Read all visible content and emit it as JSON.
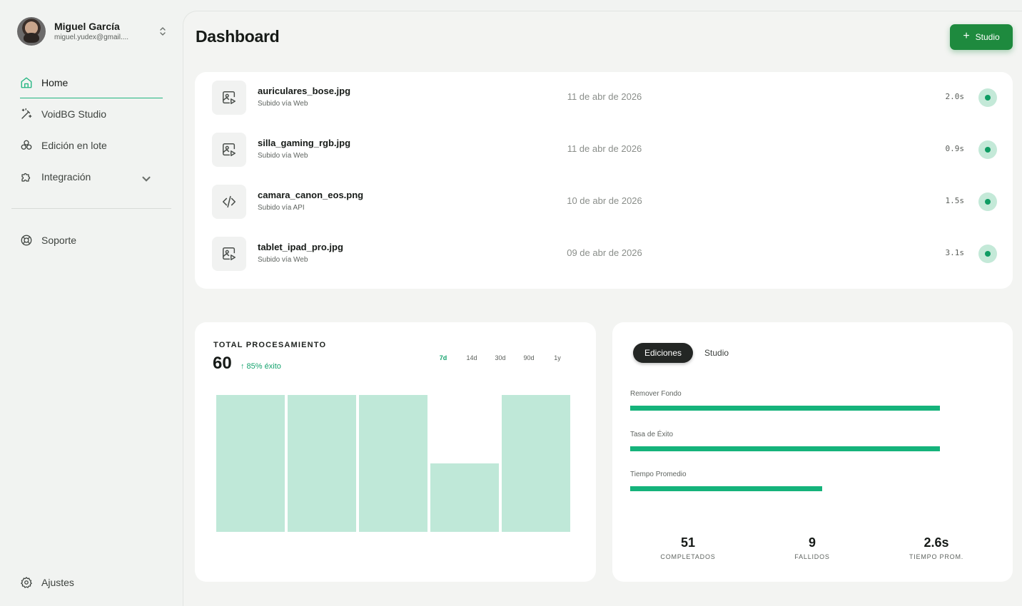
{
  "user": {
    "name": "Miguel García",
    "email": "miguel.yudex@gmail...."
  },
  "nav": {
    "items": [
      {
        "label": "Home",
        "icon": "home-icon",
        "active": true
      },
      {
        "label": "VoidBG Studio",
        "icon": "magic-wand-icon"
      },
      {
        "label": "Edición en lote",
        "icon": "batch-icon"
      },
      {
        "label": "Integración",
        "icon": "puzzle-icon",
        "has_submenu": true
      }
    ],
    "support": {
      "label": "Soporte",
      "icon": "lifebuoy-icon"
    },
    "settings": {
      "label": "Ajustes",
      "icon": "gear-icon"
    }
  },
  "header": {
    "title": "Dashboard",
    "studio_button": "Studio"
  },
  "files": [
    {
      "name": "auriculares_bose.jpg",
      "source": "Subido vía Web",
      "date": "11 de abr de 2026",
      "time": "2.0s",
      "icon": "image-play-icon"
    },
    {
      "name": "silla_gaming_rgb.jpg",
      "source": "Subido vía Web",
      "date": "11 de abr de 2026",
      "time": "0.9s",
      "icon": "image-play-icon"
    },
    {
      "name": "camara_canon_eos.png",
      "source": "Subido vía API",
      "date": "10 de abr de 2026",
      "time": "1.5s",
      "icon": "code-icon"
    },
    {
      "name": "tablet_ipad_pro.jpg",
      "source": "Subido vía Web",
      "date": "09 de abr de 2026",
      "time": "3.1s",
      "icon": "image-play-icon"
    }
  ],
  "processing": {
    "title": "TOTAL PROCESAMIENTO",
    "total": "60",
    "growth": "↑ 85% éxito",
    "ranges": [
      "7d",
      "14d",
      "30d",
      "90d",
      "1y"
    ],
    "active_range": "7d"
  },
  "chart_data": {
    "type": "bar",
    "values": [
      100,
      100,
      100,
      50,
      100
    ],
    "ylim": [
      0,
      100
    ],
    "color": "#bfe8d8",
    "grid": false
  },
  "stats": {
    "tabs": [
      "Ediciones",
      "Studio"
    ],
    "active_tab": "Ediciones",
    "metrics": [
      {
        "label": "Remover Fondo",
        "fraction": 1.0
      },
      {
        "label": "Tasa de Éxito",
        "fraction": 1.0
      },
      {
        "label": "Tiempo Promedio",
        "fraction": 0.62
      }
    ],
    "summary": [
      {
        "value": "51",
        "label": "COMPLETADOS"
      },
      {
        "value": "9",
        "label": "FALLIDOS"
      },
      {
        "value": "2.6s",
        "label": "TIEMPO PROM."
      }
    ],
    "accent": "#15b37b"
  }
}
